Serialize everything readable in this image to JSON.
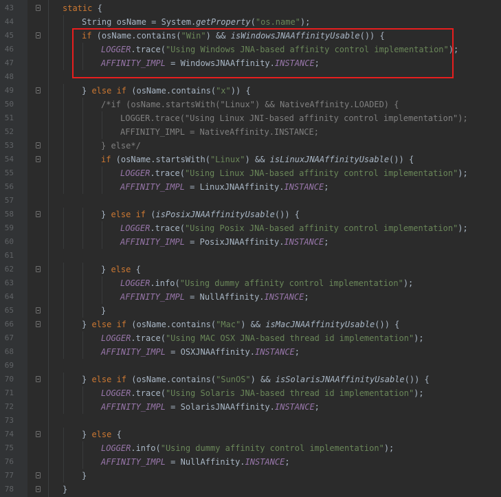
{
  "editor": {
    "lines": [
      {
        "num": "43",
        "indent": 0,
        "tokens": [
          {
            "t": "static",
            "c": "kw"
          },
          {
            "t": " {",
            "c": ""
          }
        ]
      },
      {
        "num": "44",
        "indent": 1,
        "tokens": [
          {
            "t": "String osName = System.",
            "c": ""
          },
          {
            "t": "getProperty",
            "c": "mi"
          },
          {
            "t": "(",
            "c": ""
          },
          {
            "t": "\"os.name\"",
            "c": "str"
          },
          {
            "t": ");",
            "c": ""
          }
        ]
      },
      {
        "num": "45",
        "indent": 1,
        "tokens": [
          {
            "t": "if",
            "c": "kw"
          },
          {
            "t": " (osName.contains(",
            "c": ""
          },
          {
            "t": "\"Win\"",
            "c": "str"
          },
          {
            "t": ") && ",
            "c": ""
          },
          {
            "t": "isWindowsJNAAffinityUsable",
            "c": "mi"
          },
          {
            "t": "()) {",
            "c": ""
          }
        ]
      },
      {
        "num": "46",
        "indent": 2,
        "tokens": [
          {
            "t": "LOGGER",
            "c": "st"
          },
          {
            "t": ".trace(",
            "c": ""
          },
          {
            "t": "\"Using Windows JNA-based affinity control implementation\"",
            "c": "str"
          },
          {
            "t": ");",
            "c": ""
          }
        ]
      },
      {
        "num": "47",
        "indent": 2,
        "tokens": [
          {
            "t": "AFFINITY_IMPL",
            "c": "st"
          },
          {
            "t": " = WindowsJNAAffinity.",
            "c": ""
          },
          {
            "t": "INSTANCE",
            "c": "st"
          },
          {
            "t": ";",
            "c": ""
          }
        ]
      },
      {
        "num": "48",
        "indent": 0,
        "tokens": []
      },
      {
        "num": "49",
        "indent": 1,
        "tokens": [
          {
            "t": "} ",
            "c": ""
          },
          {
            "t": "else if",
            "c": "kw"
          },
          {
            "t": " (osName.contains(",
            "c": ""
          },
          {
            "t": "\"x\"",
            "c": "str"
          },
          {
            "t": ")) {",
            "c": ""
          }
        ]
      },
      {
        "num": "50",
        "indent": 2,
        "tokens": [
          {
            "t": "/*if (osName.startsWith(\"Linux\") && NativeAffinity.LOADED) {",
            "c": "cm"
          }
        ]
      },
      {
        "num": "51",
        "indent": 3,
        "tokens": [
          {
            "t": "LOGGER.trace(\"Using Linux JNI-based affinity control implementation\");",
            "c": "cm"
          }
        ]
      },
      {
        "num": "52",
        "indent": 3,
        "tokens": [
          {
            "t": "AFFINITY_IMPL = NativeAffinity.INSTANCE;",
            "c": "cm"
          }
        ]
      },
      {
        "num": "53",
        "indent": 2,
        "tokens": [
          {
            "t": "} else*/",
            "c": "cm"
          }
        ]
      },
      {
        "num": "54",
        "indent": 2,
        "tokens": [
          {
            "t": "if",
            "c": "kw"
          },
          {
            "t": " (osName.startsWith(",
            "c": ""
          },
          {
            "t": "\"Linux\"",
            "c": "str"
          },
          {
            "t": ") && ",
            "c": ""
          },
          {
            "t": "isLinuxJNAAffinityUsable",
            "c": "mi"
          },
          {
            "t": "()) {",
            "c": ""
          }
        ]
      },
      {
        "num": "55",
        "indent": 3,
        "tokens": [
          {
            "t": "LOGGER",
            "c": "st"
          },
          {
            "t": ".trace(",
            "c": ""
          },
          {
            "t": "\"Using Linux JNA-based affinity control implementation\"",
            "c": "str"
          },
          {
            "t": ");",
            "c": ""
          }
        ]
      },
      {
        "num": "56",
        "indent": 3,
        "tokens": [
          {
            "t": "AFFINITY_IMPL",
            "c": "st"
          },
          {
            "t": " = LinuxJNAAffinity.",
            "c": ""
          },
          {
            "t": "INSTANCE",
            "c": "st"
          },
          {
            "t": ";",
            "c": ""
          }
        ]
      },
      {
        "num": "57",
        "indent": 0,
        "tokens": []
      },
      {
        "num": "58",
        "indent": 2,
        "tokens": [
          {
            "t": "} ",
            "c": ""
          },
          {
            "t": "else if",
            "c": "kw"
          },
          {
            "t": " (",
            "c": ""
          },
          {
            "t": "isPosixJNAAffinityUsable",
            "c": "mi"
          },
          {
            "t": "()) {",
            "c": ""
          }
        ]
      },
      {
        "num": "59",
        "indent": 3,
        "tokens": [
          {
            "t": "LOGGER",
            "c": "st"
          },
          {
            "t": ".trace(",
            "c": ""
          },
          {
            "t": "\"Using Posix JNA-based affinity control implementation\"",
            "c": "str"
          },
          {
            "t": ");",
            "c": ""
          }
        ]
      },
      {
        "num": "60",
        "indent": 3,
        "tokens": [
          {
            "t": "AFFINITY_IMPL",
            "c": "st"
          },
          {
            "t": " = PosixJNAAffinity.",
            "c": ""
          },
          {
            "t": "INSTANCE",
            "c": "st"
          },
          {
            "t": ";",
            "c": ""
          }
        ]
      },
      {
        "num": "61",
        "indent": 0,
        "tokens": []
      },
      {
        "num": "62",
        "indent": 2,
        "tokens": [
          {
            "t": "} ",
            "c": ""
          },
          {
            "t": "else",
            "c": "kw"
          },
          {
            "t": " {",
            "c": ""
          }
        ]
      },
      {
        "num": "63",
        "indent": 3,
        "tokens": [
          {
            "t": "LOGGER",
            "c": "st"
          },
          {
            "t": ".info(",
            "c": ""
          },
          {
            "t": "\"Using dummy affinity control implementation\"",
            "c": "str"
          },
          {
            "t": ");",
            "c": ""
          }
        ]
      },
      {
        "num": "64",
        "indent": 3,
        "tokens": [
          {
            "t": "AFFINITY_IMPL",
            "c": "st"
          },
          {
            "t": " = NullAffinity.",
            "c": ""
          },
          {
            "t": "INSTANCE",
            "c": "st"
          },
          {
            "t": ";",
            "c": ""
          }
        ]
      },
      {
        "num": "65",
        "indent": 2,
        "tokens": [
          {
            "t": "}",
            "c": ""
          }
        ]
      },
      {
        "num": "66",
        "indent": 1,
        "tokens": [
          {
            "t": "} ",
            "c": ""
          },
          {
            "t": "else if",
            "c": "kw"
          },
          {
            "t": " (osName.contains(",
            "c": ""
          },
          {
            "t": "\"Mac\"",
            "c": "str"
          },
          {
            "t": ") && ",
            "c": ""
          },
          {
            "t": "isMacJNAAffinityUsable",
            "c": "mi"
          },
          {
            "t": "()) {",
            "c": ""
          }
        ]
      },
      {
        "num": "67",
        "indent": 2,
        "tokens": [
          {
            "t": "LOGGER",
            "c": "st"
          },
          {
            "t": ".trace(",
            "c": ""
          },
          {
            "t": "\"Using MAC OSX JNA-based thread id implementation\"",
            "c": "str"
          },
          {
            "t": ");",
            "c": ""
          }
        ]
      },
      {
        "num": "68",
        "indent": 2,
        "tokens": [
          {
            "t": "AFFINITY_IMPL",
            "c": "st"
          },
          {
            "t": " = OSXJNAAffinity.",
            "c": ""
          },
          {
            "t": "INSTANCE",
            "c": "st"
          },
          {
            "t": ";",
            "c": ""
          }
        ]
      },
      {
        "num": "69",
        "indent": 0,
        "tokens": []
      },
      {
        "num": "70",
        "indent": 1,
        "tokens": [
          {
            "t": "} ",
            "c": ""
          },
          {
            "t": "else if",
            "c": "kw"
          },
          {
            "t": " (osName.contains(",
            "c": ""
          },
          {
            "t": "\"SunOS\"",
            "c": "str"
          },
          {
            "t": ") && ",
            "c": ""
          },
          {
            "t": "isSolarisJNAAffinityUsable",
            "c": "mi"
          },
          {
            "t": "()) {",
            "c": ""
          }
        ]
      },
      {
        "num": "71",
        "indent": 2,
        "tokens": [
          {
            "t": "LOGGER",
            "c": "st"
          },
          {
            "t": ".trace(",
            "c": ""
          },
          {
            "t": "\"Using Solaris JNA-based thread id implementation\"",
            "c": "str"
          },
          {
            "t": ");",
            "c": ""
          }
        ]
      },
      {
        "num": "72",
        "indent": 2,
        "tokens": [
          {
            "t": "AFFINITY_IMPL",
            "c": "st"
          },
          {
            "t": " = SolarisJNAAffinity.",
            "c": ""
          },
          {
            "t": "INSTANCE",
            "c": "st"
          },
          {
            "t": ";",
            "c": ""
          }
        ]
      },
      {
        "num": "73",
        "indent": 0,
        "tokens": []
      },
      {
        "num": "74",
        "indent": 1,
        "tokens": [
          {
            "t": "} ",
            "c": ""
          },
          {
            "t": "else",
            "c": "kw"
          },
          {
            "t": " {",
            "c": ""
          }
        ]
      },
      {
        "num": "75",
        "indent": 2,
        "tokens": [
          {
            "t": "LOGGER",
            "c": "st"
          },
          {
            "t": ".info(",
            "c": ""
          },
          {
            "t": "\"Using dummy affinity control implementation\"",
            "c": "str"
          },
          {
            "t": ");",
            "c": ""
          }
        ]
      },
      {
        "num": "76",
        "indent": 2,
        "tokens": [
          {
            "t": "AFFINITY_IMPL",
            "c": "st"
          },
          {
            "t": " = NullAffinity.",
            "c": ""
          },
          {
            "t": "INSTANCE",
            "c": "st"
          },
          {
            "t": ";",
            "c": ""
          }
        ]
      },
      {
        "num": "77",
        "indent": 1,
        "tokens": [
          {
            "t": "}",
            "c": ""
          }
        ]
      },
      {
        "num": "78",
        "indent": 0,
        "tokens": [
          {
            "t": "}",
            "c": ""
          }
        ]
      }
    ],
    "fold_markers": [
      "43",
      "45",
      "49",
      "53",
      "54",
      "58",
      "62",
      "65",
      "66",
      "70",
      "74",
      "77",
      "78"
    ],
    "highlight": {
      "from_line": "45",
      "to_line": "47",
      "color": "#e81e1e"
    }
  },
  "colors": {
    "background": "#2b2b2b",
    "gutter": "#313335",
    "keyword": "#cc7832",
    "string": "#6a8759",
    "static_field": "#9876aa",
    "comment": "#808080",
    "text": "#a9b7c6",
    "line_number": "#606366"
  }
}
